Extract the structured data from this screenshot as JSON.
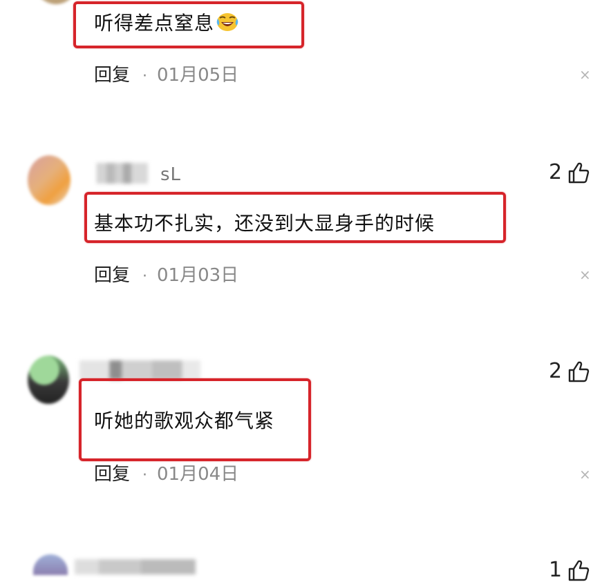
{
  "comments": [
    {
      "text": "听得差点窒息",
      "emoji": "laugh-cry-emoji",
      "reply_label": "回复",
      "separator": "·",
      "date": "01月05日"
    },
    {
      "username_suffix": "sL",
      "likes": "2",
      "text": "基本功不扎实，还没到大显身手的时候",
      "reply_label": "回复",
      "separator": "·",
      "date": "01月03日"
    },
    {
      "likes": "2",
      "text": "听她的歌观众都气紧",
      "reply_label": "回复",
      "separator": "·",
      "date": "01月04日"
    },
    {
      "likes": "1"
    }
  ],
  "close_glyph": "×",
  "colors": {
    "highlight_box": "#d6242a",
    "date_text": "#888888",
    "close_icon": "#b5b5b5"
  }
}
